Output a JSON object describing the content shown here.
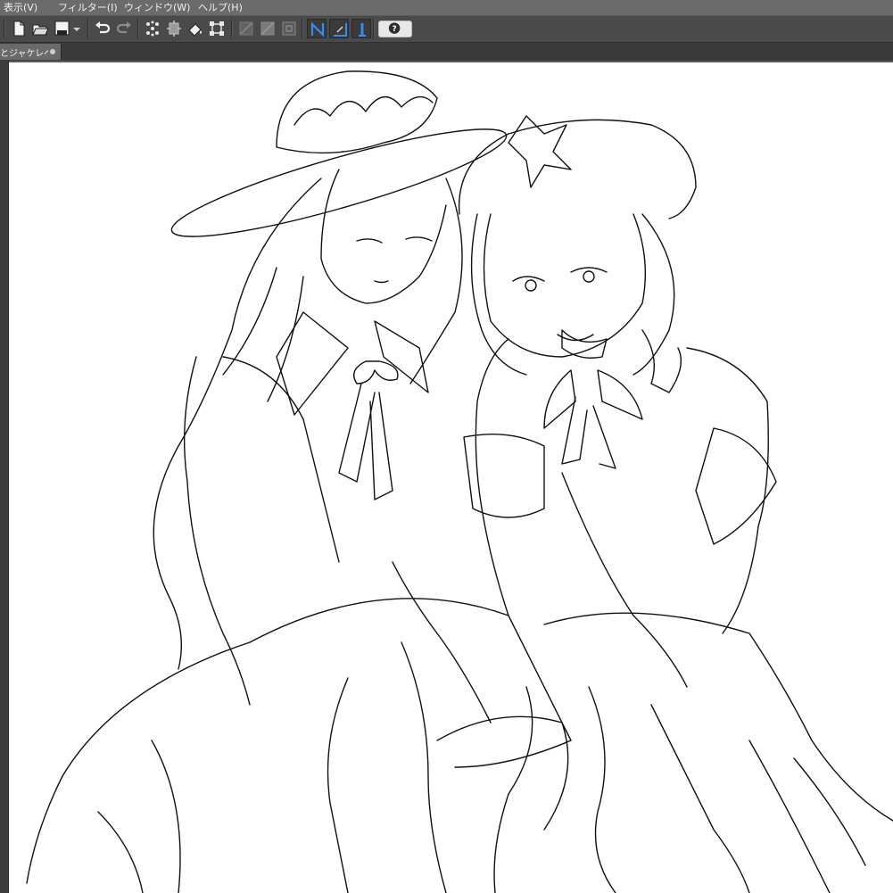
{
  "menubar": {
    "items": [
      {
        "label": "表示(V)"
      },
      {
        "label": "フィルター(I)"
      },
      {
        "label": "ウィンドウ(W)"
      },
      {
        "label": "ヘルプ(H)"
      }
    ]
  },
  "toolbar": {
    "icons": [
      "new-canvas-icon",
      "open-folder-icon",
      "save-icon",
      "dropdown-arrow-icon",
      "undo-icon",
      "redo-icon",
      "selection-transform-icon",
      "fit-icon",
      "fill-icon",
      "scale-icon",
      "ruler-snap-icon",
      "grid-snap-icon",
      "special-snap-icon",
      "snap-ruler-icon",
      "snap-guide-icon",
      "snap-3d-icon",
      "help-icon"
    ],
    "help_label": "?"
  },
  "tabs": [
    {
      "label": "とジャケレベ*",
      "modified": true
    }
  ],
  "canvas": {
    "background": "#ffffff",
    "content": "line-art illustration"
  },
  "colors": {
    "menubar_bg": "#6b6b6b",
    "toolbar_bg": "#4a4a4a",
    "active_toggle": "#2f78d0",
    "canvas_bg": "#ffffff"
  }
}
